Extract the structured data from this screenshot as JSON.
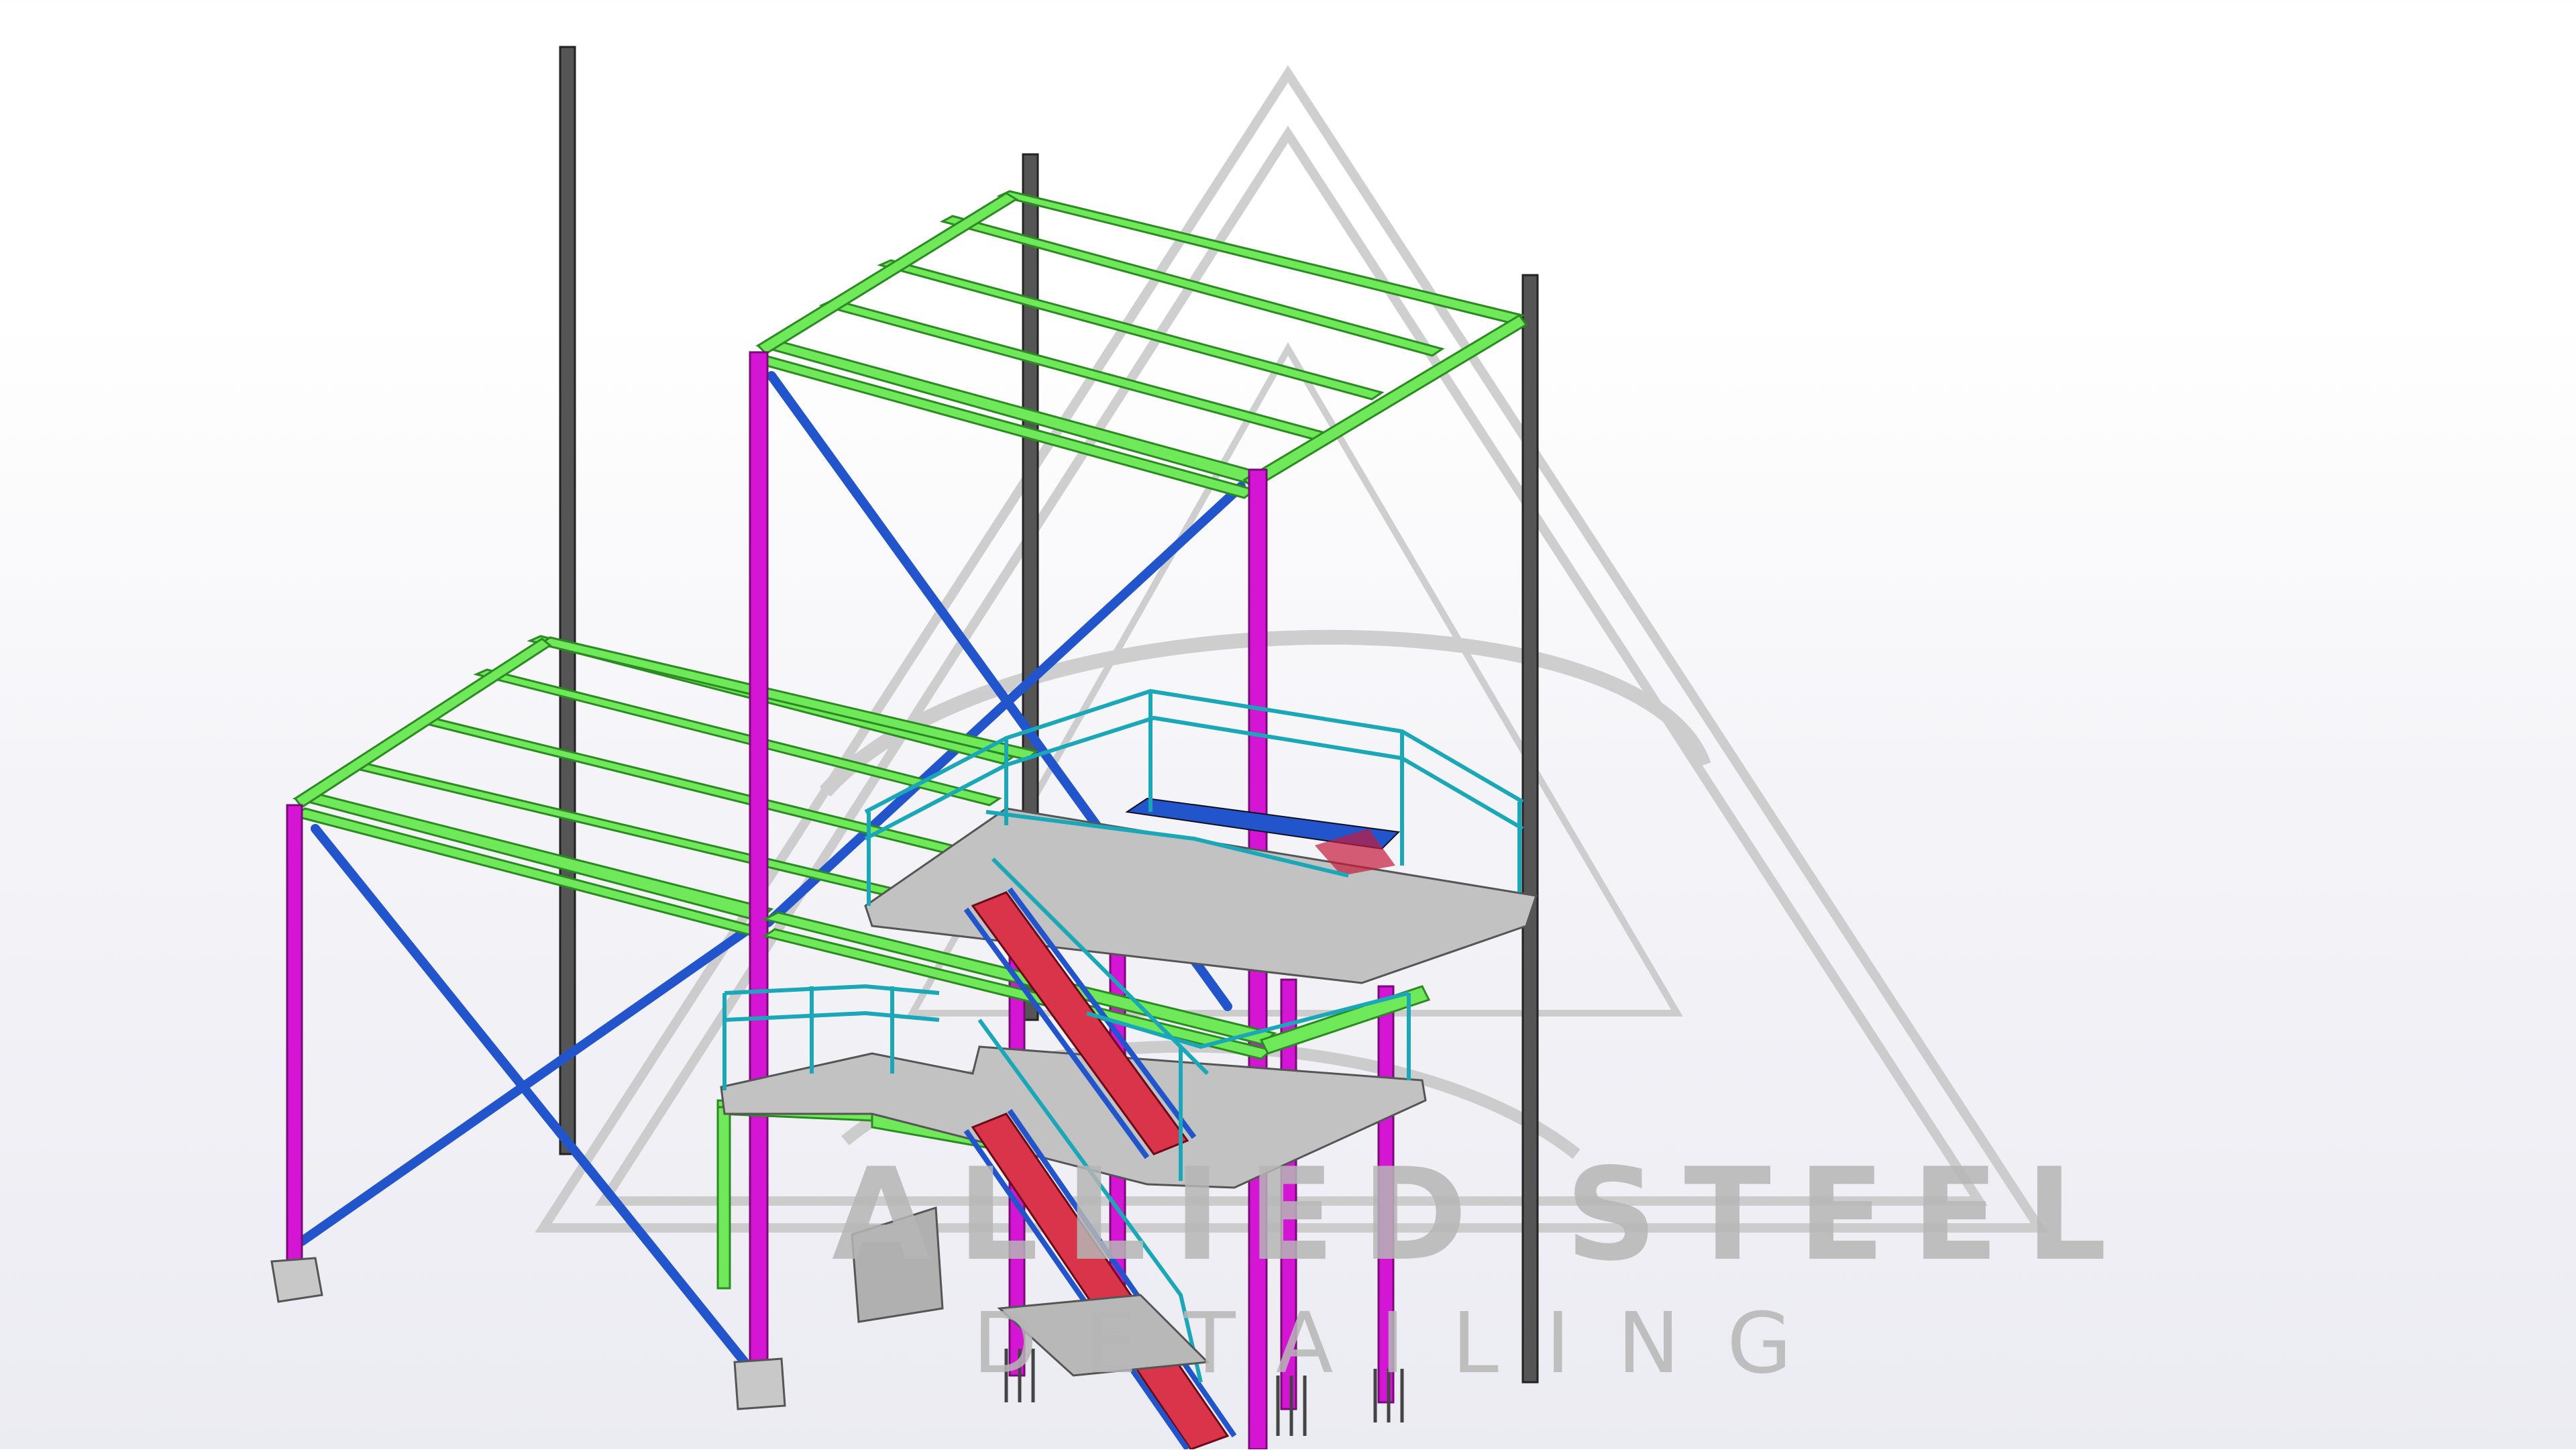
{
  "watermark": {
    "line1": "ALLIED STEEL",
    "line2": "DETAILING"
  },
  "colors": {
    "beam": "#6fe85a",
    "column": "#d416d4",
    "brace": "#2255cc",
    "handrail": "#1aa8b8",
    "stair_tread": "#d9344a",
    "grating": "#b8b8b8",
    "steel_gray": "#555555",
    "watermark": "#b6b6b6"
  },
  "model_parts": [
    "beam",
    "column",
    "brace",
    "handrail",
    "stair-tread",
    "grating",
    "gray-column",
    "footing",
    "anchor-bolt"
  ]
}
